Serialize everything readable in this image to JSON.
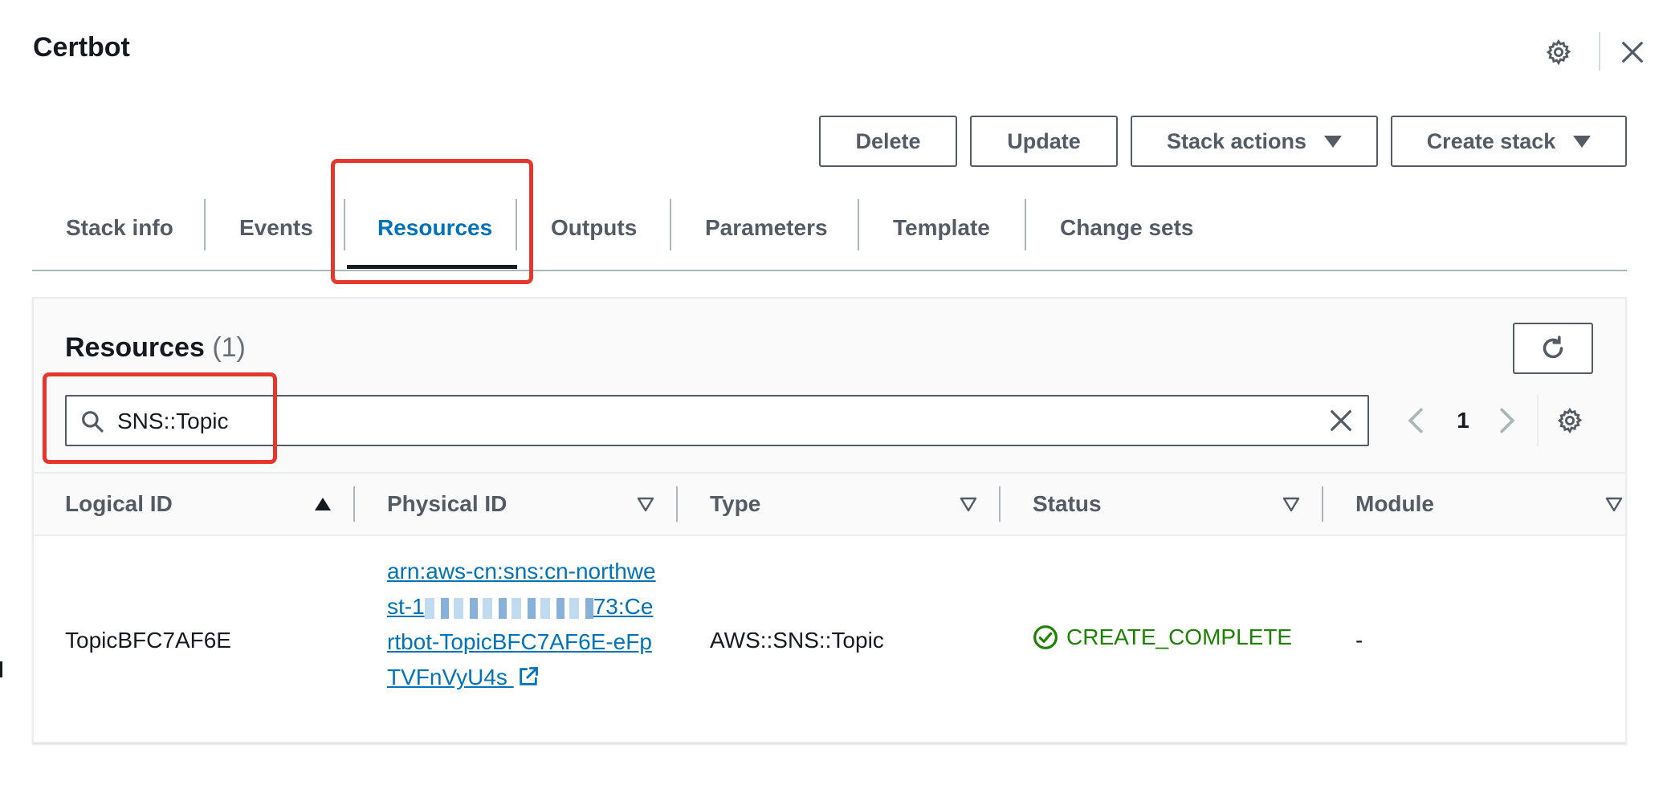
{
  "header": {
    "title": "Certbot",
    "settings_icon": "gear-icon",
    "close_icon": "close-icon"
  },
  "actions": {
    "delete": "Delete",
    "update": "Update",
    "stack_actions": "Stack actions",
    "create_stack": "Create stack"
  },
  "tabs": [
    {
      "label": "Stack info"
    },
    {
      "label": "Events"
    },
    {
      "label": "Resources",
      "active": true
    },
    {
      "label": "Outputs"
    },
    {
      "label": "Parameters"
    },
    {
      "label": "Template"
    },
    {
      "label": "Change sets"
    }
  ],
  "resources": {
    "title": "Resources",
    "count": "(1)",
    "search": {
      "value": "SNS::Topic"
    },
    "pagination": {
      "current_page": "1"
    },
    "columns": [
      "Logical ID",
      "Physical ID",
      "Type",
      "Status",
      "Module"
    ],
    "rows": [
      {
        "logical_id": "TopicBFC7AF6E",
        "physical_id_start": "arn:aws-cn:sns:cn-northwest-1",
        "physical_id_end": "73:Certbot-TopicBFC7AF6E-eFpTVFnVyU4s",
        "type": "AWS::SNS::Topic",
        "status": "CREATE_COMPLETE",
        "module": "-"
      }
    ]
  },
  "colors": {
    "accent_blue": "#0073bb",
    "success_green": "#1d8102",
    "annotation_red": "#e6372e",
    "text_dark": "#16191f",
    "text_muted": "#545b64"
  }
}
